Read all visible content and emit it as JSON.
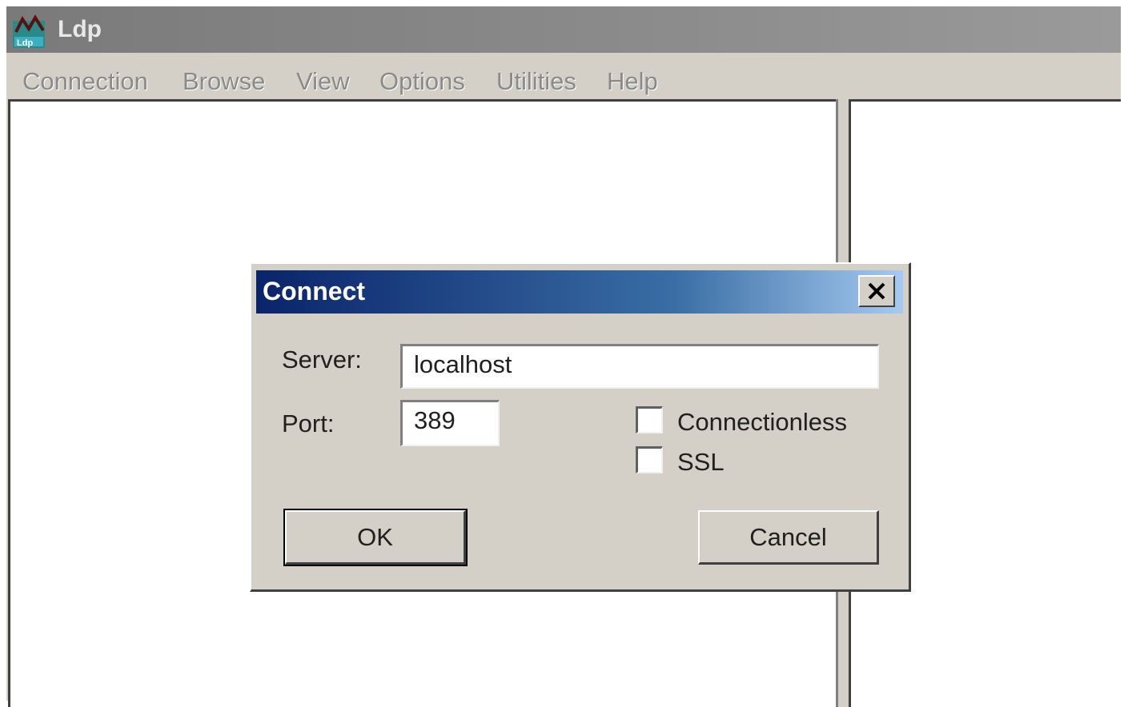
{
  "app": {
    "title": "Ldp",
    "icon": "ldp-app-icon"
  },
  "menu": {
    "items": [
      {
        "label": "Connection"
      },
      {
        "label": "Browse"
      },
      {
        "label": "View"
      },
      {
        "label": "Options"
      },
      {
        "label": "Utilities"
      },
      {
        "label": "Help"
      }
    ]
  },
  "dialog": {
    "title": "Connect",
    "close_icon": "close-icon",
    "server_label": "Server:",
    "server_value": "localhost",
    "port_label": "Port:",
    "port_value": "389",
    "connectionless_label": "Connectionless",
    "connectionless_checked": false,
    "ssl_label": "SSL",
    "ssl_checked": false,
    "ok_label": "OK",
    "cancel_label": "Cancel"
  },
  "colors": {
    "dialog_title_start": "#0a246a",
    "dialog_title_end": "#a6caf0",
    "window_face": "#d4d0c8"
  }
}
